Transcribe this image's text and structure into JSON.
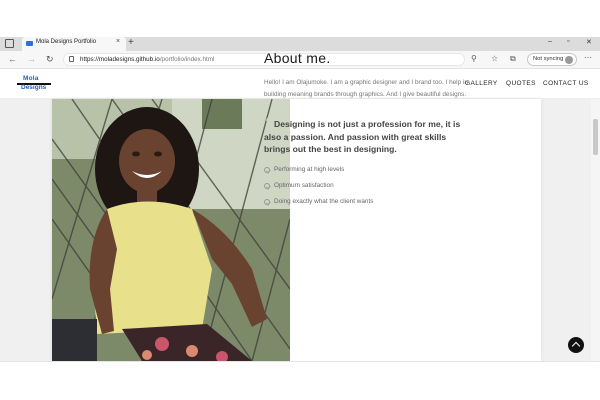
{
  "browser": {
    "tab_title": "Mola Designs Portfolio",
    "tab_close": "×",
    "new_tab": "+",
    "url_host": "https://moladesigns.github.io",
    "url_path": "/portfolio/index.html",
    "sync_label": "Not syncing",
    "window_controls": [
      "–",
      "▫",
      "✕"
    ],
    "more_label": "⋯"
  },
  "site": {
    "logo_top": "Mola",
    "logo_bottom": "Designs",
    "nav": [
      "GALLERY",
      "QUOTES",
      "CONTACT US"
    ]
  },
  "about": {
    "title": "About me.",
    "text": "Hello! I am Olajumoke. I am a graphic designer and I brand too. I help in building meaning brands through graphics. And I give beautiful designs.",
    "quote": "Designing is not just a profession for me, it is also a passion. And passion with great skills brings out the best in designing.",
    "list": [
      "Performing at high levels",
      "Optimum satisfaction",
      "Doing exactly what the client wants"
    ]
  },
  "colors": {
    "accent": "#1f5fb5",
    "heading": "#1a1a1a",
    "muted_text": "#777777"
  }
}
